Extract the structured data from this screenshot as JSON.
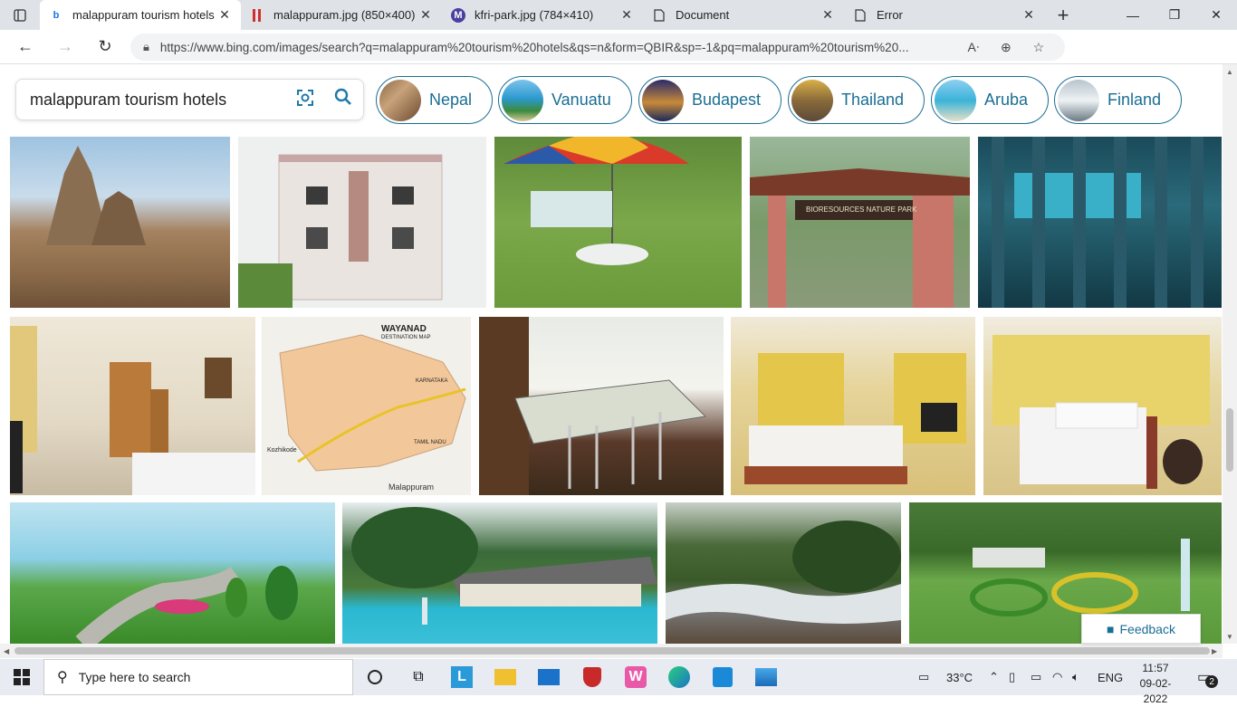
{
  "tabs": [
    {
      "label": "malappuram tourism hotels -",
      "favicon": "bing-icon",
      "active": true
    },
    {
      "label": "malappuram.jpg (850×400)",
      "favicon": "image-icon",
      "active": false
    },
    {
      "label": "kfri-park.jpg (784×410)",
      "favicon": "m-icon",
      "active": false
    },
    {
      "label": "Document",
      "favicon": "document-icon",
      "active": false
    },
    {
      "label": "Error",
      "favicon": "document-icon",
      "active": false
    }
  ],
  "address_bar": {
    "url": "https://www.bing.com/images/search?q=malappuram%20tourism%20hotels&qs=n&form=QBIR&sp=-1&pq=malappuram%20tourism%20..."
  },
  "search": {
    "query": "malappuram tourism hotels"
  },
  "related_pills": [
    {
      "label": "Nepal"
    },
    {
      "label": "Vanuatu"
    },
    {
      "label": "Budapest"
    },
    {
      "label": "Thailand"
    },
    {
      "label": "Aruba"
    },
    {
      "label": "Finland"
    }
  ],
  "images": {
    "map_title": "WAYANAD",
    "map_sub": "DESTINATION MAP",
    "map_state": "KARNATAKA",
    "map_city": "Kozhikode",
    "map_state2": "TAMIL NADU",
    "map_caption": "Malappuram",
    "nature_park_sign": "BIORESOURCES NATURE PARK"
  },
  "feedback": {
    "label": "Feedback"
  },
  "taskbar": {
    "search_placeholder": "Type here to search",
    "temperature": "33°C",
    "language": "ENG",
    "time": "11:57",
    "date": "09-02-2022",
    "notifications": "2"
  }
}
